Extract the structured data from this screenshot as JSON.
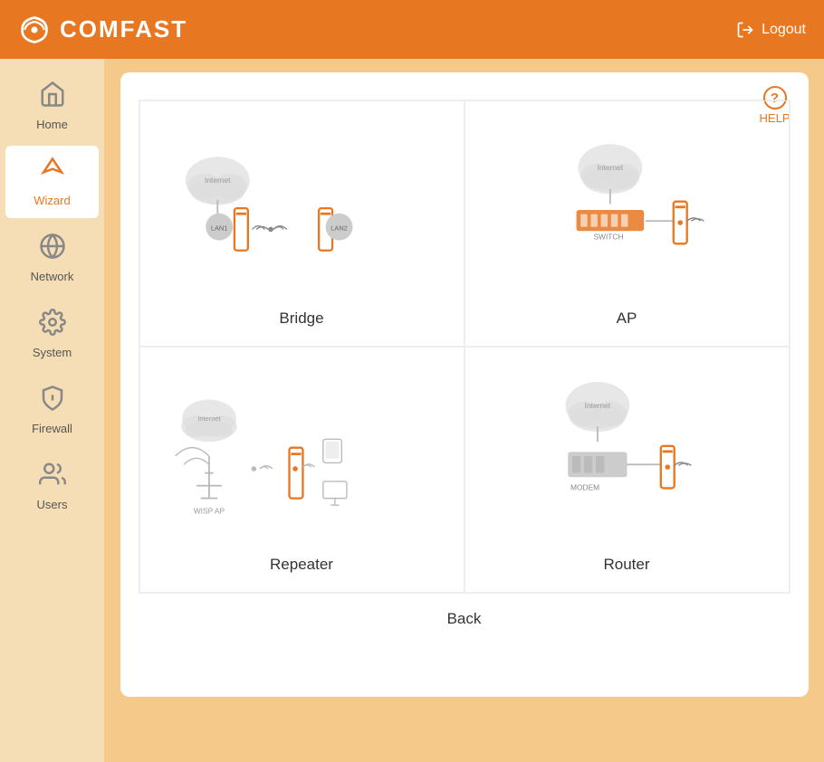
{
  "header": {
    "logo_text": "COMFAST",
    "logout_label": "Logout"
  },
  "sidebar": {
    "items": [
      {
        "id": "home",
        "label": "Home",
        "icon": "🏠",
        "active": false
      },
      {
        "id": "wizard",
        "label": "Wizard",
        "icon": "🔀",
        "active": true
      },
      {
        "id": "network",
        "label": "Network",
        "icon": "🌐",
        "active": false
      },
      {
        "id": "system",
        "label": "System",
        "icon": "⚙️",
        "active": false
      },
      {
        "id": "firewall",
        "label": "Firewall",
        "icon": "🔥",
        "active": false
      },
      {
        "id": "users",
        "label": "Users",
        "icon": "👥",
        "active": false
      }
    ]
  },
  "content": {
    "help_label": "HELP",
    "modes": [
      {
        "id": "bridge",
        "label": "Bridge"
      },
      {
        "id": "ap",
        "label": "AP"
      },
      {
        "id": "repeater",
        "label": "Repeater"
      },
      {
        "id": "router",
        "label": "Router"
      }
    ],
    "back_label": "Back"
  },
  "colors": {
    "orange": "#e87722",
    "light_orange": "#f5c98a",
    "gray": "#aaa",
    "dark_gray": "#666"
  }
}
